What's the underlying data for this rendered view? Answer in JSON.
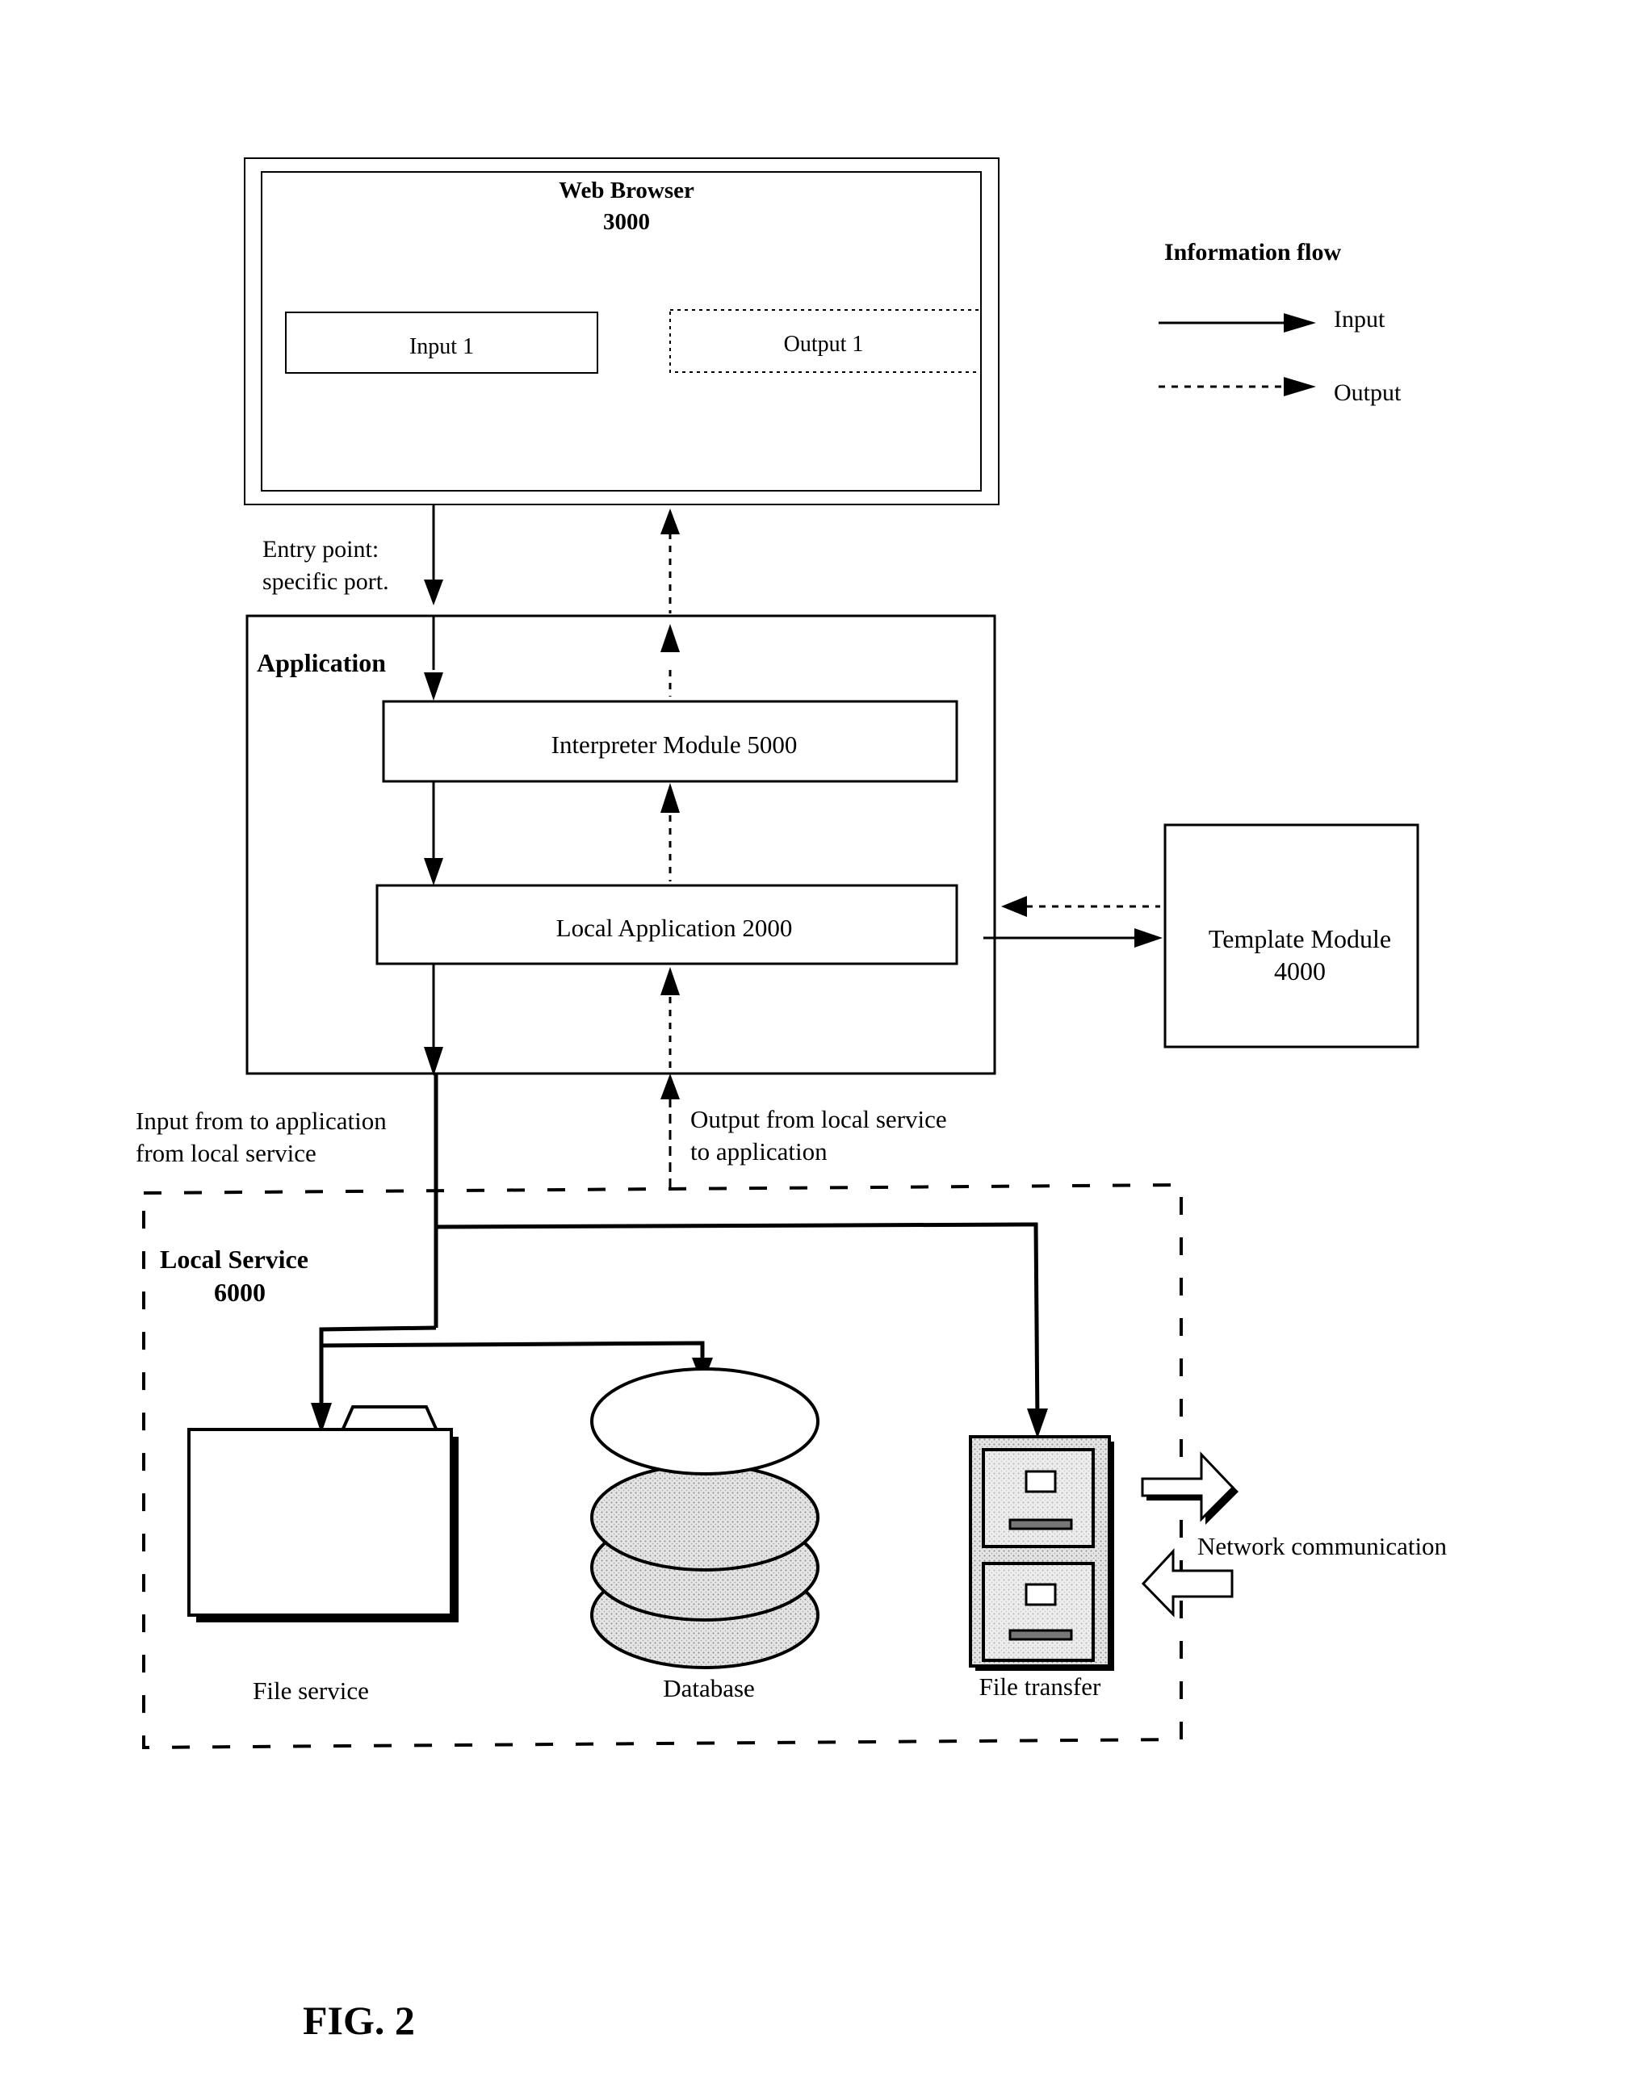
{
  "figure": {
    "label": "FIG. 2"
  },
  "legend": {
    "title": "Information flow",
    "items": [
      {
        "style": "solid",
        "label": "Input"
      },
      {
        "style": "dotted",
        "label": "Output"
      }
    ]
  },
  "web_browser": {
    "title": "Web Browser",
    "number": "3000",
    "input_field": "Input 1",
    "output_field": "Output 1"
  },
  "entry_point": {
    "line1": "Entry point:",
    "line2": "specific port."
  },
  "application": {
    "title": "Application",
    "interpreter": "Interpreter Module  5000",
    "local_app": "Local Application  2000"
  },
  "template_module": {
    "title": "Template Module",
    "number": "4000"
  },
  "flow_labels": {
    "input_line1": "Input from to application",
    "input_line2": "from local service",
    "output_line1": "Output from local service",
    "output_line2": "to application"
  },
  "local_service": {
    "title": "Local Service",
    "number": "6000",
    "file_service": "File service",
    "database": "Database",
    "file_transfer": "File transfer",
    "network": "Network communication"
  }
}
